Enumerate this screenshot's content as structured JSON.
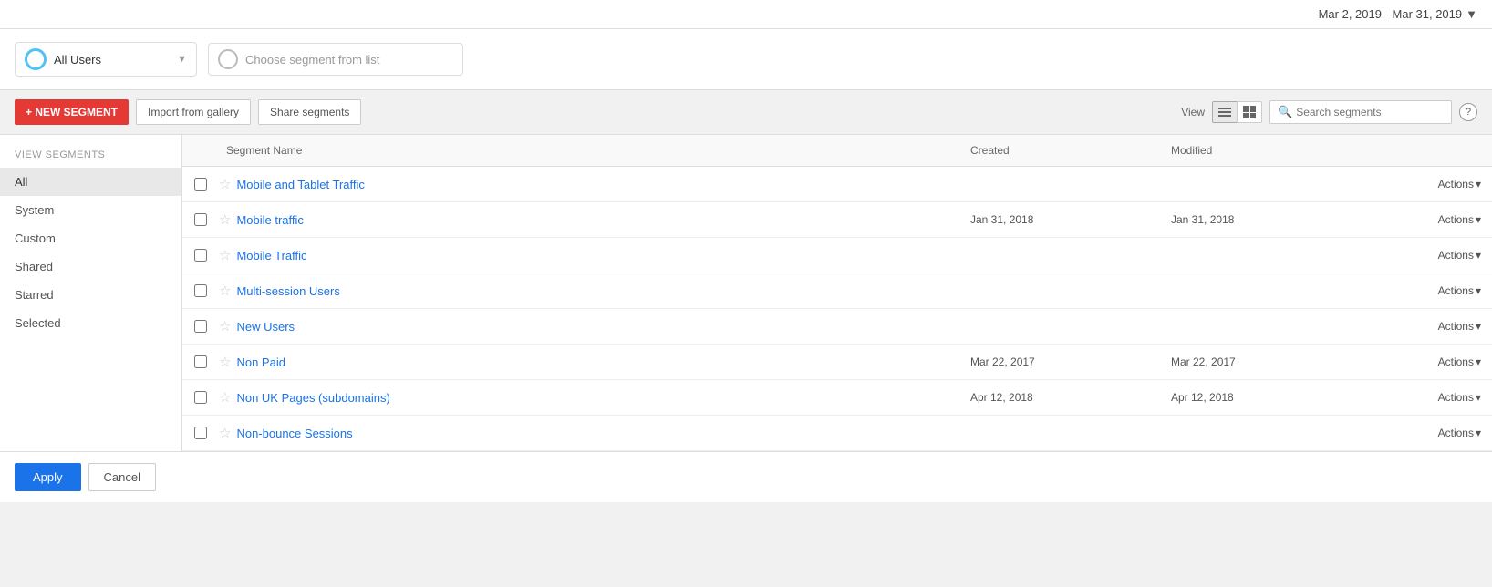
{
  "top_bar": {
    "date_range": "Mar 2, 2019 - Mar 31, 2019",
    "chevron": "▼"
  },
  "segment_selector": {
    "selected_label": "All Users",
    "chevron": "▼",
    "placeholder": "Choose segment from list"
  },
  "toolbar": {
    "new_segment_label": "+ NEW SEGMENT",
    "import_label": "Import from gallery",
    "share_label": "Share segments",
    "view_label": "View",
    "search_placeholder": "Search segments",
    "help_label": "?"
  },
  "sidebar": {
    "section_label": "VIEW SEGMENTS",
    "items": [
      {
        "id": "all",
        "label": "All",
        "active": true
      },
      {
        "id": "system",
        "label": "System",
        "active": false
      },
      {
        "id": "custom",
        "label": "Custom",
        "active": false
      },
      {
        "id": "shared",
        "label": "Shared",
        "active": false
      },
      {
        "id": "starred",
        "label": "Starred",
        "active": false
      },
      {
        "id": "selected",
        "label": "Selected",
        "active": false
      }
    ]
  },
  "table": {
    "headers": {
      "name": "Segment Name",
      "created": "Created",
      "modified": "Modified",
      "actions": ""
    },
    "rows": [
      {
        "id": 1,
        "name": "Mobile and Tablet Traffic",
        "created": "",
        "modified": "",
        "actions": "Actions"
      },
      {
        "id": 2,
        "name": "Mobile traffic",
        "created": "Jan 31, 2018",
        "modified": "Jan 31, 2018",
        "actions": "Actions"
      },
      {
        "id": 3,
        "name": "Mobile Traffic",
        "created": "",
        "modified": "",
        "actions": "Actions"
      },
      {
        "id": 4,
        "name": "Multi-session Users",
        "created": "",
        "modified": "",
        "actions": "Actions"
      },
      {
        "id": 5,
        "name": "New Users",
        "created": "",
        "modified": "",
        "actions": "Actions"
      },
      {
        "id": 6,
        "name": "Non Paid",
        "created": "Mar 22, 2017",
        "modified": "Mar 22, 2017",
        "actions": "Actions"
      },
      {
        "id": 7,
        "name": "Non UK Pages (subdomains)",
        "created": "Apr 12, 2018",
        "modified": "Apr 12, 2018",
        "actions": "Actions"
      },
      {
        "id": 8,
        "name": "Non-bounce Sessions",
        "created": "",
        "modified": "",
        "actions": "Actions"
      }
    ]
  },
  "bottom_bar": {
    "apply_label": "Apply",
    "cancel_label": "Cancel"
  }
}
